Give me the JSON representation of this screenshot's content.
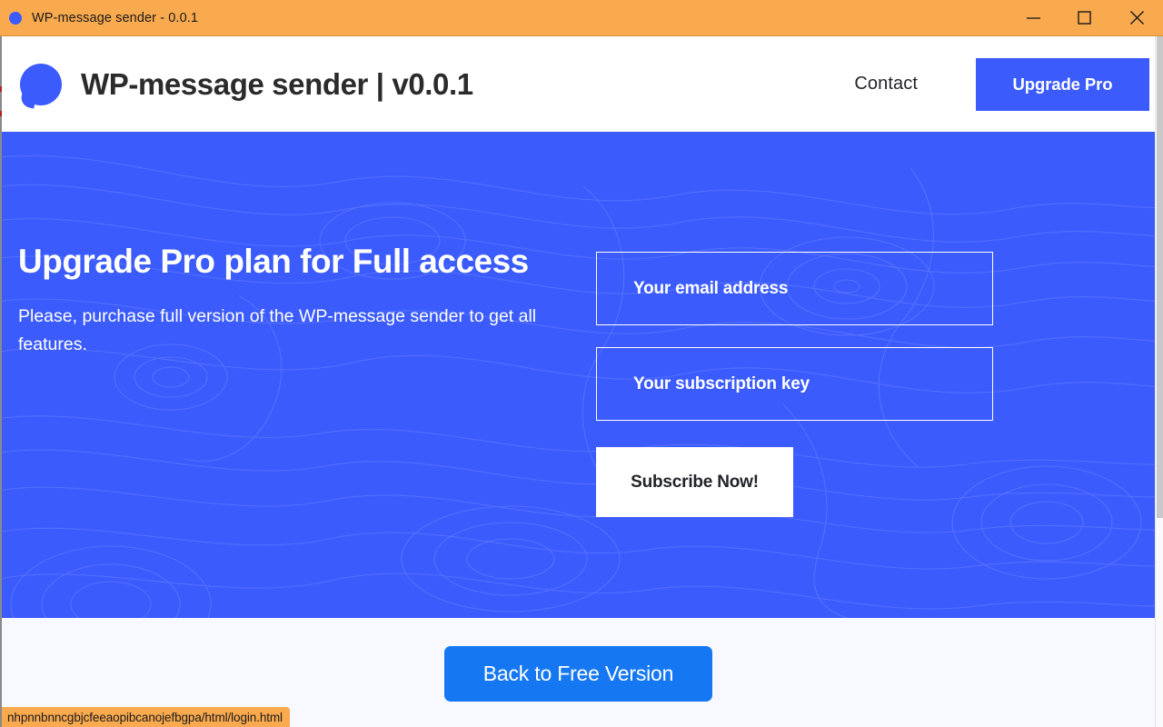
{
  "window": {
    "title": "WP-message sender - 0.0.1",
    "icon": "bubble-icon",
    "controls": {
      "minimize": "minimize-icon",
      "maximize": "maximize-icon",
      "close": "close-icon"
    },
    "titlebar_color": "#f9a94e"
  },
  "header": {
    "logo": "speech-bubble-logo",
    "brand_title": "WP-message sender | v0.0.1",
    "nav": {
      "contact_label": "Contact",
      "upgrade_label": "Upgrade Pro"
    }
  },
  "hero": {
    "title": "Upgrade Pro plan for Full access",
    "subtitle": "Please, purchase full version of the WP-message sender to get all features.",
    "background_color": "#3b5bfd",
    "form": {
      "email": {
        "placeholder": "Your email address",
        "value": ""
      },
      "subscription_key": {
        "placeholder": "Your subscription key",
        "value": ""
      },
      "submit_label": "Subscribe Now!"
    }
  },
  "footer": {
    "back_label": "Back to Free Version",
    "button_color": "#1577f2",
    "background_color": "#f7f9fe"
  },
  "status_bar": {
    "url": "nhpnnbnncgbjcfeeaopibcanojefbgpa/html/login.html"
  }
}
